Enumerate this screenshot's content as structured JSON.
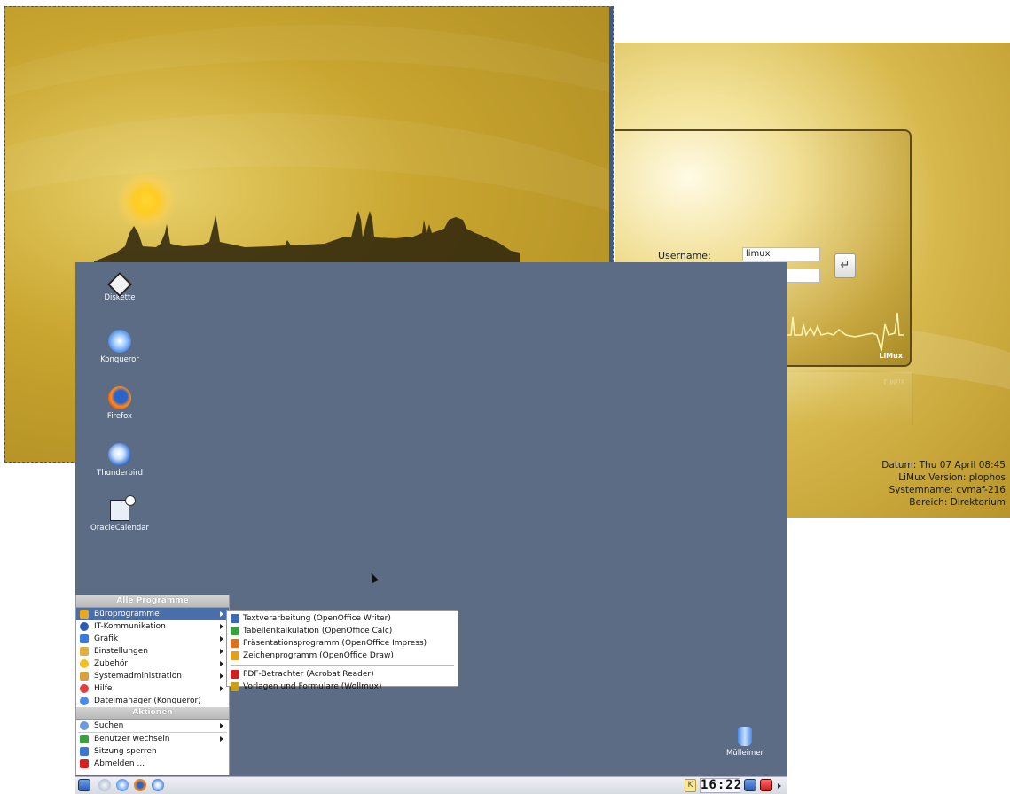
{
  "login": {
    "username_label": "Username:",
    "username_value": "limux",
    "enter_symbol": "↵",
    "brand": "LiMux",
    "sysinfo": {
      "date": "Datum: Thu 07 April 08:45",
      "version": "LiMux Version: plophos",
      "systemname": "Systemname: cvmaf-216",
      "area": "Bereich: Direktorium"
    }
  },
  "desktop": {
    "icons": [
      {
        "label": "Diskette",
        "icon": "diskette-icon"
      },
      {
        "label": "Konqueror",
        "icon": "konqueror-icon"
      },
      {
        "label": "Firefox",
        "icon": "firefox-icon"
      },
      {
        "label": "Thunderbird",
        "icon": "thunderbird-icon"
      },
      {
        "label": "OracleCalendar",
        "icon": "calendar-icon"
      },
      {
        "label": "Mülleimer",
        "icon": "trash-icon"
      }
    ]
  },
  "kmenu": {
    "header_programs": "Alle Programme",
    "items": [
      {
        "label": "Büroprogramme",
        "submenu": true,
        "color": "#e8a820"
      },
      {
        "label": "IT-Kommunikation",
        "submenu": true,
        "color": "#2a5bb0"
      },
      {
        "label": "Grafik",
        "submenu": true,
        "color": "#3a7ad8"
      },
      {
        "label": "Einstellungen",
        "submenu": true,
        "color": "#e0b040"
      },
      {
        "label": "Zubehör",
        "submenu": true,
        "color": "#f0c020"
      },
      {
        "label": "Systemadministration",
        "submenu": true,
        "color": "#d8a040"
      },
      {
        "label": "Hilfe",
        "submenu": true,
        "color": "#e04040"
      },
      {
        "label": "Dateimanager (Konqueror)",
        "submenu": false,
        "color": "#4a8ae8"
      }
    ],
    "header_actions": "Aktionen",
    "actions": [
      {
        "label": "Suchen",
        "submenu": true,
        "color": "#6a9ae0"
      },
      {
        "label": "Benutzer wechseln",
        "submenu": true,
        "color": "#3aa040"
      },
      {
        "label": "Sitzung sperren",
        "submenu": false,
        "color": "#3a78d8"
      },
      {
        "label": "Abmelden ...",
        "submenu": false,
        "color": "#d82020"
      }
    ]
  },
  "submenu": {
    "items": [
      {
        "label": "Textverarbeitung (OpenOffice Writer)",
        "color": "#3a6ab8"
      },
      {
        "label": "Tabellenkalkulation (OpenOffice Calc)",
        "color": "#3aa040"
      },
      {
        "label": "Präsentationsprogramm (OpenOffice Impress)",
        "color": "#e07020"
      },
      {
        "label": "Zeichenprogramm (OpenOffice Draw)",
        "color": "#e0a020"
      }
    ],
    "items2": [
      {
        "label": "PDF-Betrachter (Acrobat Reader)",
        "color": "#d02020"
      },
      {
        "label": "Vorlagen und Formulare (Wollmux)",
        "color": "#c8a020"
      }
    ]
  },
  "taskbar": {
    "clock": "16:22",
    "kicker_letter": "K"
  }
}
